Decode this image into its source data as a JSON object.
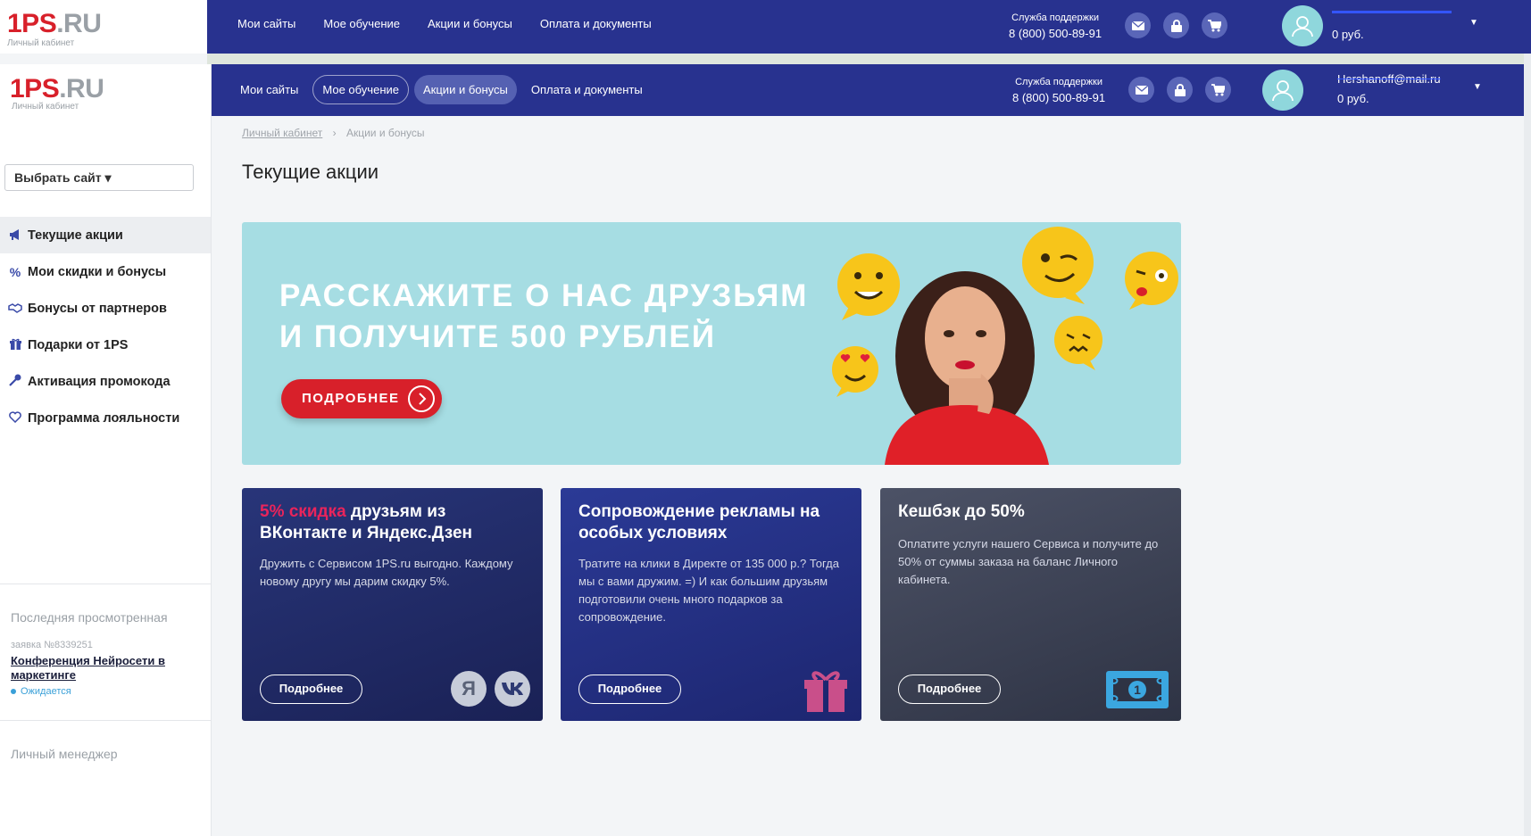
{
  "ghost": {
    "logo_main": "1PS",
    "logo_tld": ".RU",
    "logo_sub": "Личный кабинет",
    "nav": [
      "Мои сайты",
      "Мое обучение",
      "Акции и бонусы",
      "Оплата и документы"
    ],
    "support_label": "Служба поддержки",
    "support_phone": "8 (800) 500-89-91",
    "balance": "0 руб."
  },
  "sidebar": {
    "logo_main": "1PS",
    "logo_tld": ".RU",
    "logo_sub": "Личный кабинет",
    "site_select": "Выбрать сайт ▾",
    "items": [
      {
        "label": "Текущие акции",
        "icon": "megaphone-icon"
      },
      {
        "label": "Мои скидки и бонусы",
        "icon": "percent-icon"
      },
      {
        "label": "Бонусы от партнеров",
        "icon": "handshake-icon"
      },
      {
        "label": "Подарки от 1PS",
        "icon": "gift-icon"
      },
      {
        "label": "Активация промокода",
        "icon": "key-icon"
      },
      {
        "label": "Программа лояльности",
        "icon": "heart-icon"
      }
    ],
    "last_viewed": {
      "title": "Последняя просмотренная",
      "number": "заявка №8339251",
      "link": "Конференция Нейросети в маркетинге",
      "status": "Ожидается"
    },
    "manager_title": "Личный менеджер"
  },
  "header": {
    "nav": [
      "Мои сайты",
      "Мое обучение",
      "Акции и бонусы",
      "Оплата и документы"
    ],
    "support_label": "Служба поддержки",
    "support_phone": "8 (800) 500-89-91",
    "email": "Hershanoff@mail.ru",
    "balance": "0 руб.",
    "icons": [
      "mail-icon",
      "lock-icon",
      "cart-icon"
    ]
  },
  "breadcrumb": {
    "root": "Личный кабинет",
    "sep": "›",
    "current": "Акции и бонусы"
  },
  "page_title": "Текущие акции",
  "banner": {
    "line1": "РАССКАЖИТЕ О НАС ДРУЗЬЯМ",
    "line2": "И ПОЛУЧИТЕ 500 РУБЛЕЙ",
    "button": "ПОДРОБНЕЕ"
  },
  "cards": [
    {
      "title_highlight": "5% скидка",
      "title_rest": " друзьям из ВКонтакте и Яндекс.Дзен",
      "text": "Дружить с Сервисом 1PS.ru выгодно. Каждому новому другу мы дарим скидку 5%.",
      "button": "Подробнее",
      "icons": [
        "Я",
        "vk"
      ]
    },
    {
      "title": "Сопровождение рекламы на особых условиях",
      "text": "Тратите на клики в Директе от 135 000 р.? Тогда мы с вами дружим. =) И как большим друзьям подготовили очень много подарков за сопровождение.",
      "button": "Подробнее"
    },
    {
      "title": "Кешбэк до 50%",
      "text": "Оплатите услуги нашего Сервиса и получите до 50% от суммы заказа на баланс Личного кабинета.",
      "button": "Подробнее"
    }
  ],
  "colors": {
    "header_bg": "#28328f",
    "accent_red": "#d8202a",
    "banner_bg": "#a6dde3",
    "highlight_pink": "#e9245b"
  }
}
